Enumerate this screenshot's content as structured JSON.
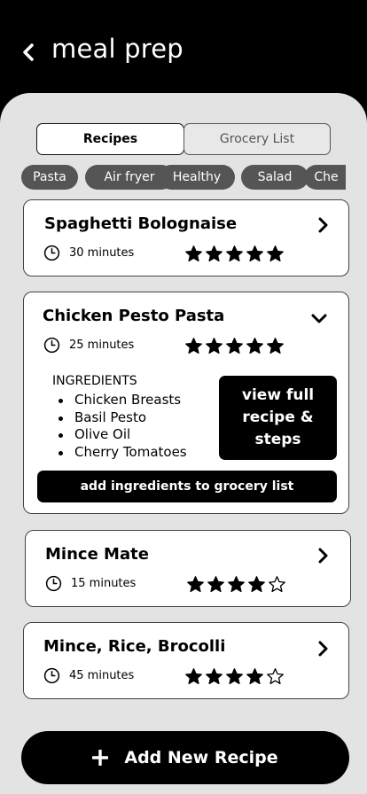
{
  "header": {
    "title": "meal prep",
    "back_icon": "chevron-left-icon"
  },
  "tabs": {
    "recipes": "Recipes",
    "grocery": "Grocery List",
    "active": "Recipes"
  },
  "filters": [
    "Pasta",
    "Air fryer",
    "Healthy",
    "Salad",
    "Che"
  ],
  "recipes": [
    {
      "name": "Spaghetti Bolognaise",
      "time": "30 minutes",
      "rating": 5,
      "expanded": false
    },
    {
      "name": "Chicken Pesto Pasta",
      "time": "25 minutes",
      "rating": 5,
      "expanded": true,
      "ingredients_title": "INGREDIENTS",
      "ingredients": [
        "Chicken Breasts",
        "Basil Pesto",
        "Olive Oil",
        "Cherry Tomatoes"
      ],
      "view_label": "view full recipe & steps",
      "grocery_label": "add ingredients to grocery list"
    },
    {
      "name": "Mince Mate",
      "time": "15 minutes",
      "rating": 4,
      "expanded": false
    },
    {
      "name": "Mince, Rice, Brocolli",
      "time": "45 minutes",
      "rating": 4,
      "expanded": false
    }
  ],
  "add_button": {
    "label": "Add New Recipe",
    "icon": "plus-icon"
  },
  "colors": {
    "background": "#000000",
    "panel": "#e3e3e3",
    "chip": "#555555",
    "accent": "#000000"
  }
}
